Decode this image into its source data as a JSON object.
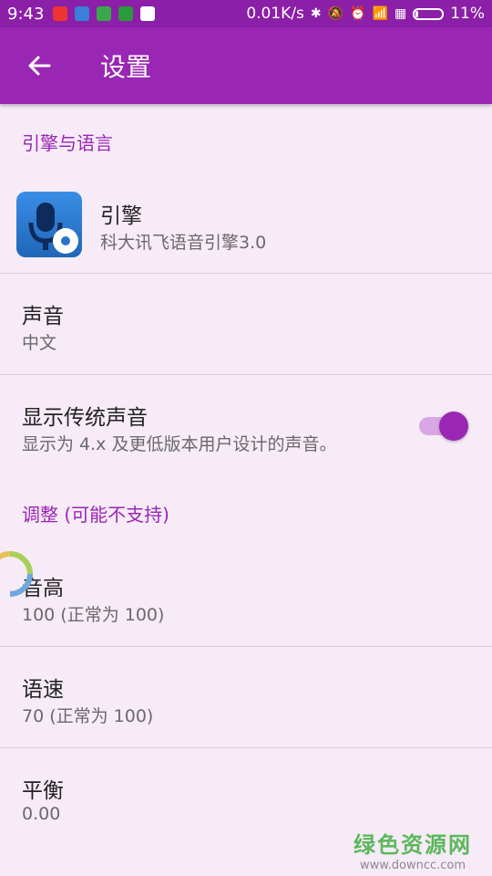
{
  "status_bar": {
    "time": "9:43",
    "net_speed": "0.01K/s",
    "battery": "11%"
  },
  "app_bar": {
    "title": "设置"
  },
  "sections": {
    "engine_lang": "引擎与语言",
    "adjust": "调整 (可能不支持)"
  },
  "items": {
    "engine": {
      "title": "引擎",
      "subtitle": "科大讯飞语音引擎3.0"
    },
    "voice": {
      "title": "声音",
      "subtitle": "中文"
    },
    "legacy_voice": {
      "title": "显示传统声音",
      "subtitle": "显示为 4.x 及更低版本用户设计的声音。",
      "enabled": true
    },
    "pitch": {
      "title": "音高",
      "subtitle": "100 (正常为 100)"
    },
    "speed": {
      "title": "语速",
      "subtitle": "70 (正常为 100)"
    },
    "balance": {
      "title": "平衡",
      "subtitle": "0.00"
    }
  },
  "watermark": {
    "main": "绿色资源网",
    "sub": "www.downcc.com"
  },
  "colors": {
    "primary": "#9a26b4",
    "status": "#8b1fa8",
    "background": "#f6ebf7"
  }
}
